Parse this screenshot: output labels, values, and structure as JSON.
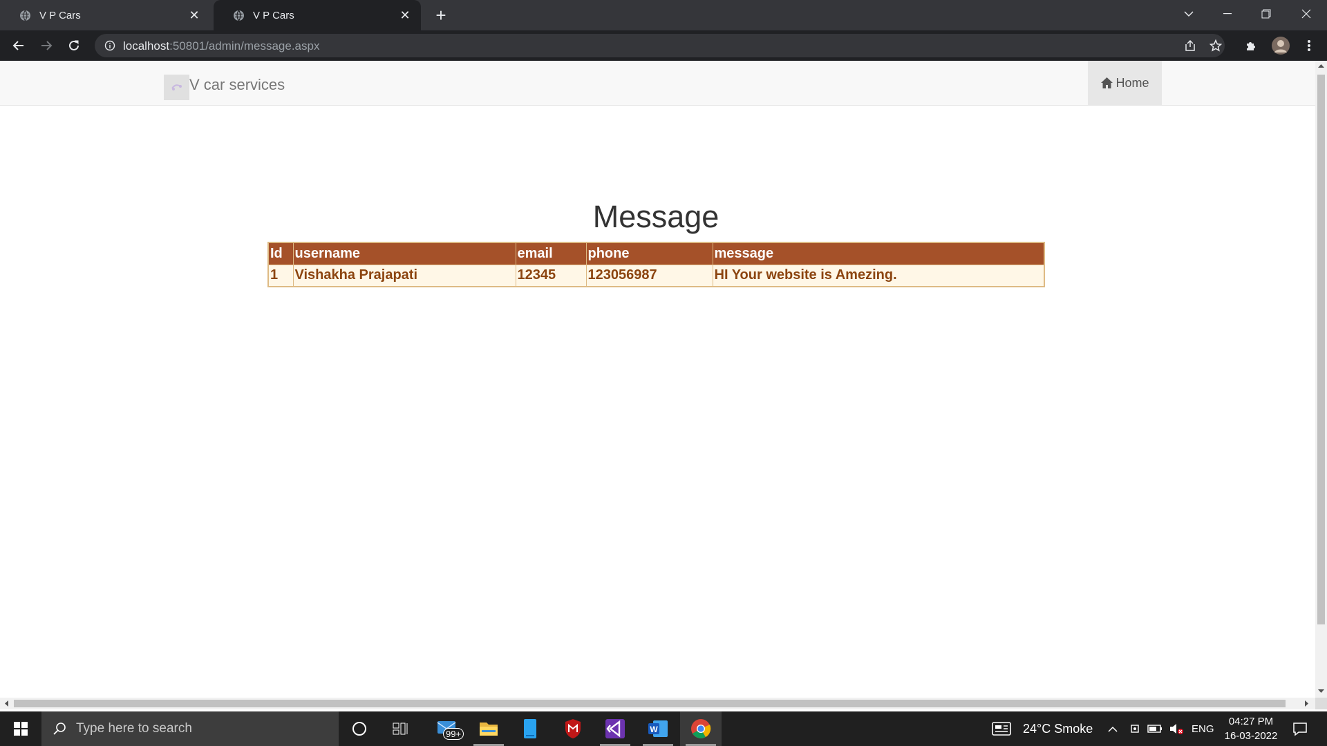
{
  "browser": {
    "tabs": [
      {
        "title": "V P Cars",
        "active": false
      },
      {
        "title": "V P Cars",
        "active": true
      }
    ],
    "url_host": "localhost",
    "url_rest": ":50801/admin/message.aspx"
  },
  "site": {
    "brand": "V car services",
    "nav_home": "Home"
  },
  "page": {
    "title": "Message",
    "table": {
      "headers": [
        "Id",
        "username",
        "email",
        "phone",
        "message"
      ],
      "rows": [
        [
          "1",
          "Vishakha Prajapati",
          "12345",
          "123056987",
          "HI Your website is Amezing."
        ]
      ]
    }
  },
  "taskbar": {
    "search_placeholder": "Type here to search",
    "mail_badge": "99+",
    "weather": "24°C  Smoke",
    "language": "ENG",
    "time": "04:27 PM",
    "date": "16-03-2022"
  },
  "colors": {
    "table_header_bg": "#a55129",
    "table_row_bg": "#fff7e7",
    "table_row_text": "#8c4510",
    "table_border": "#deba84"
  }
}
